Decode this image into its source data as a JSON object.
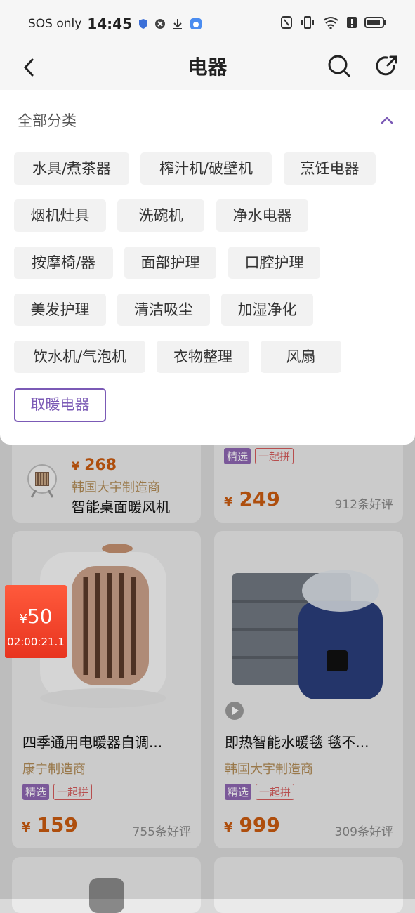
{
  "status_bar": {
    "carrier": "SOS only",
    "time": "14:45"
  },
  "header": {
    "title": "电器"
  },
  "panel": {
    "title": "全部分类",
    "categories": [
      "水具/煮茶器",
      "榨汁机/破壁机",
      "烹饪电器",
      "烟机灶具",
      "洗碗机",
      "净水电器",
      "按摩椅/器",
      "面部护理",
      "口腔护理",
      "美发护理",
      "清洁吸尘",
      "加湿净化",
      "饮水机/气泡机",
      "衣物整理",
      "风扇",
      "取暖电器"
    ],
    "selected": "取暖电器"
  },
  "products": {
    "p1": {
      "price_symbol": "¥",
      "price": "268",
      "maker": "韩国大宇制造商",
      "name": "智能桌面暖风机"
    },
    "p2": {
      "tag1": "精选",
      "tag2": "一起拼",
      "price_symbol": "¥",
      "price": "249",
      "reviews": "912条好评"
    },
    "p3": {
      "name": "四季通用电暖器自调...",
      "maker": "康宁制造商",
      "tag1": "精选",
      "tag2": "一起拼",
      "price_symbol": "¥",
      "price": "159",
      "reviews": "755条好评",
      "badge_symbol": "¥",
      "badge_value": "50",
      "badge_timer": "02:00:21.1"
    },
    "p4": {
      "name": "即热智能水暖毯 毯不...",
      "maker": "韩国大宇制造商",
      "tag1": "精选",
      "tag2": "一起拼",
      "price_symbol": "¥",
      "price": "999",
      "reviews": "309条好评"
    }
  },
  "colors": {
    "accent": "#7b5ab6",
    "price": "#c85a10",
    "maker": "#b08a55",
    "badge": "#e8341f"
  }
}
